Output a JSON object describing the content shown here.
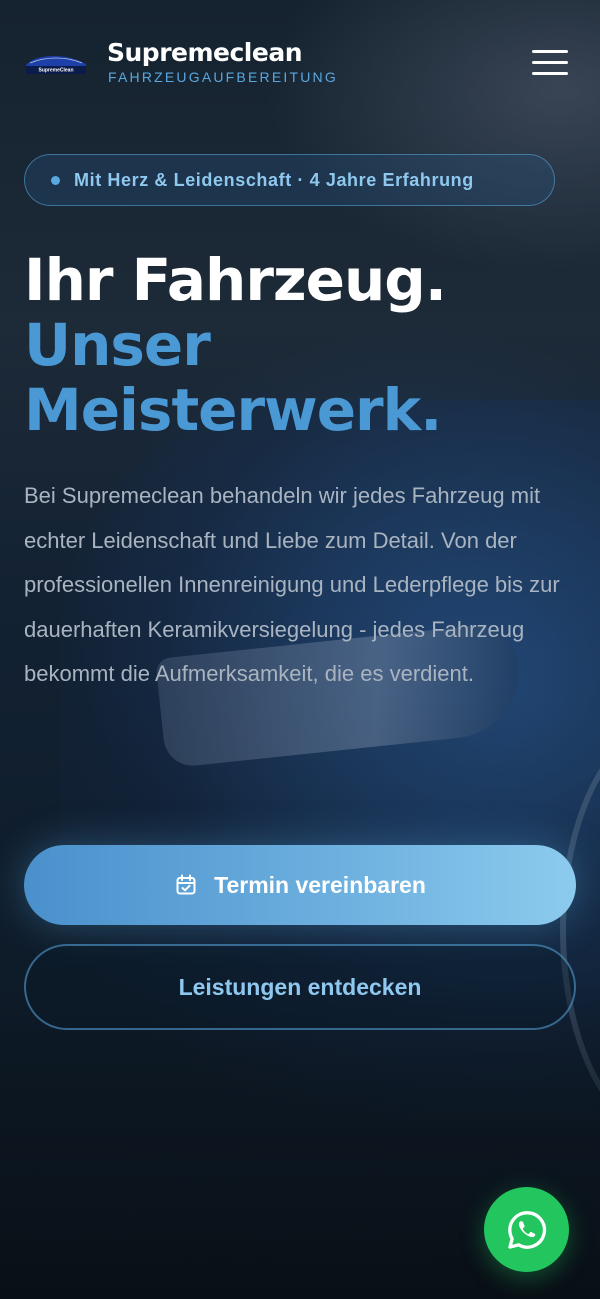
{
  "brand": {
    "logo_text": "SupremeClean",
    "name": "Supremeclean",
    "subtitle": "FAHRZEUGAUFBEREITUNG"
  },
  "header": {
    "menu_icon": "hamburger-menu-icon"
  },
  "hero": {
    "badge": "Mit Herz & Leidenschaft · 4 Jahre Erfahrung",
    "headline_line1": "Ihr Fahrzeug.",
    "headline_line2": "Unser",
    "headline_line3": "Meisterwerk.",
    "lead": "Bei Supremeclean behandeln wir jedes Fahrzeug mit echter Leidenschaft und Liebe zum Detail. Von der professionellen Innenreinigung und Lederpflege bis zur dauerhaften Keramikversiegelung - jedes Fahrzeug bekommt die Aufmerksamkeit, die es verdient."
  },
  "actions": {
    "primary_label": "Termin vereinbaren",
    "primary_icon": "calendar-check-icon",
    "secondary_label": "Leistungen entdecken"
  },
  "floating": {
    "whatsapp_icon": "whatsapp-icon"
  },
  "colors": {
    "accent": "#4a98d4",
    "accent_light": "#8fc8ef",
    "whatsapp": "#22c55e",
    "background": "#0d1620"
  }
}
